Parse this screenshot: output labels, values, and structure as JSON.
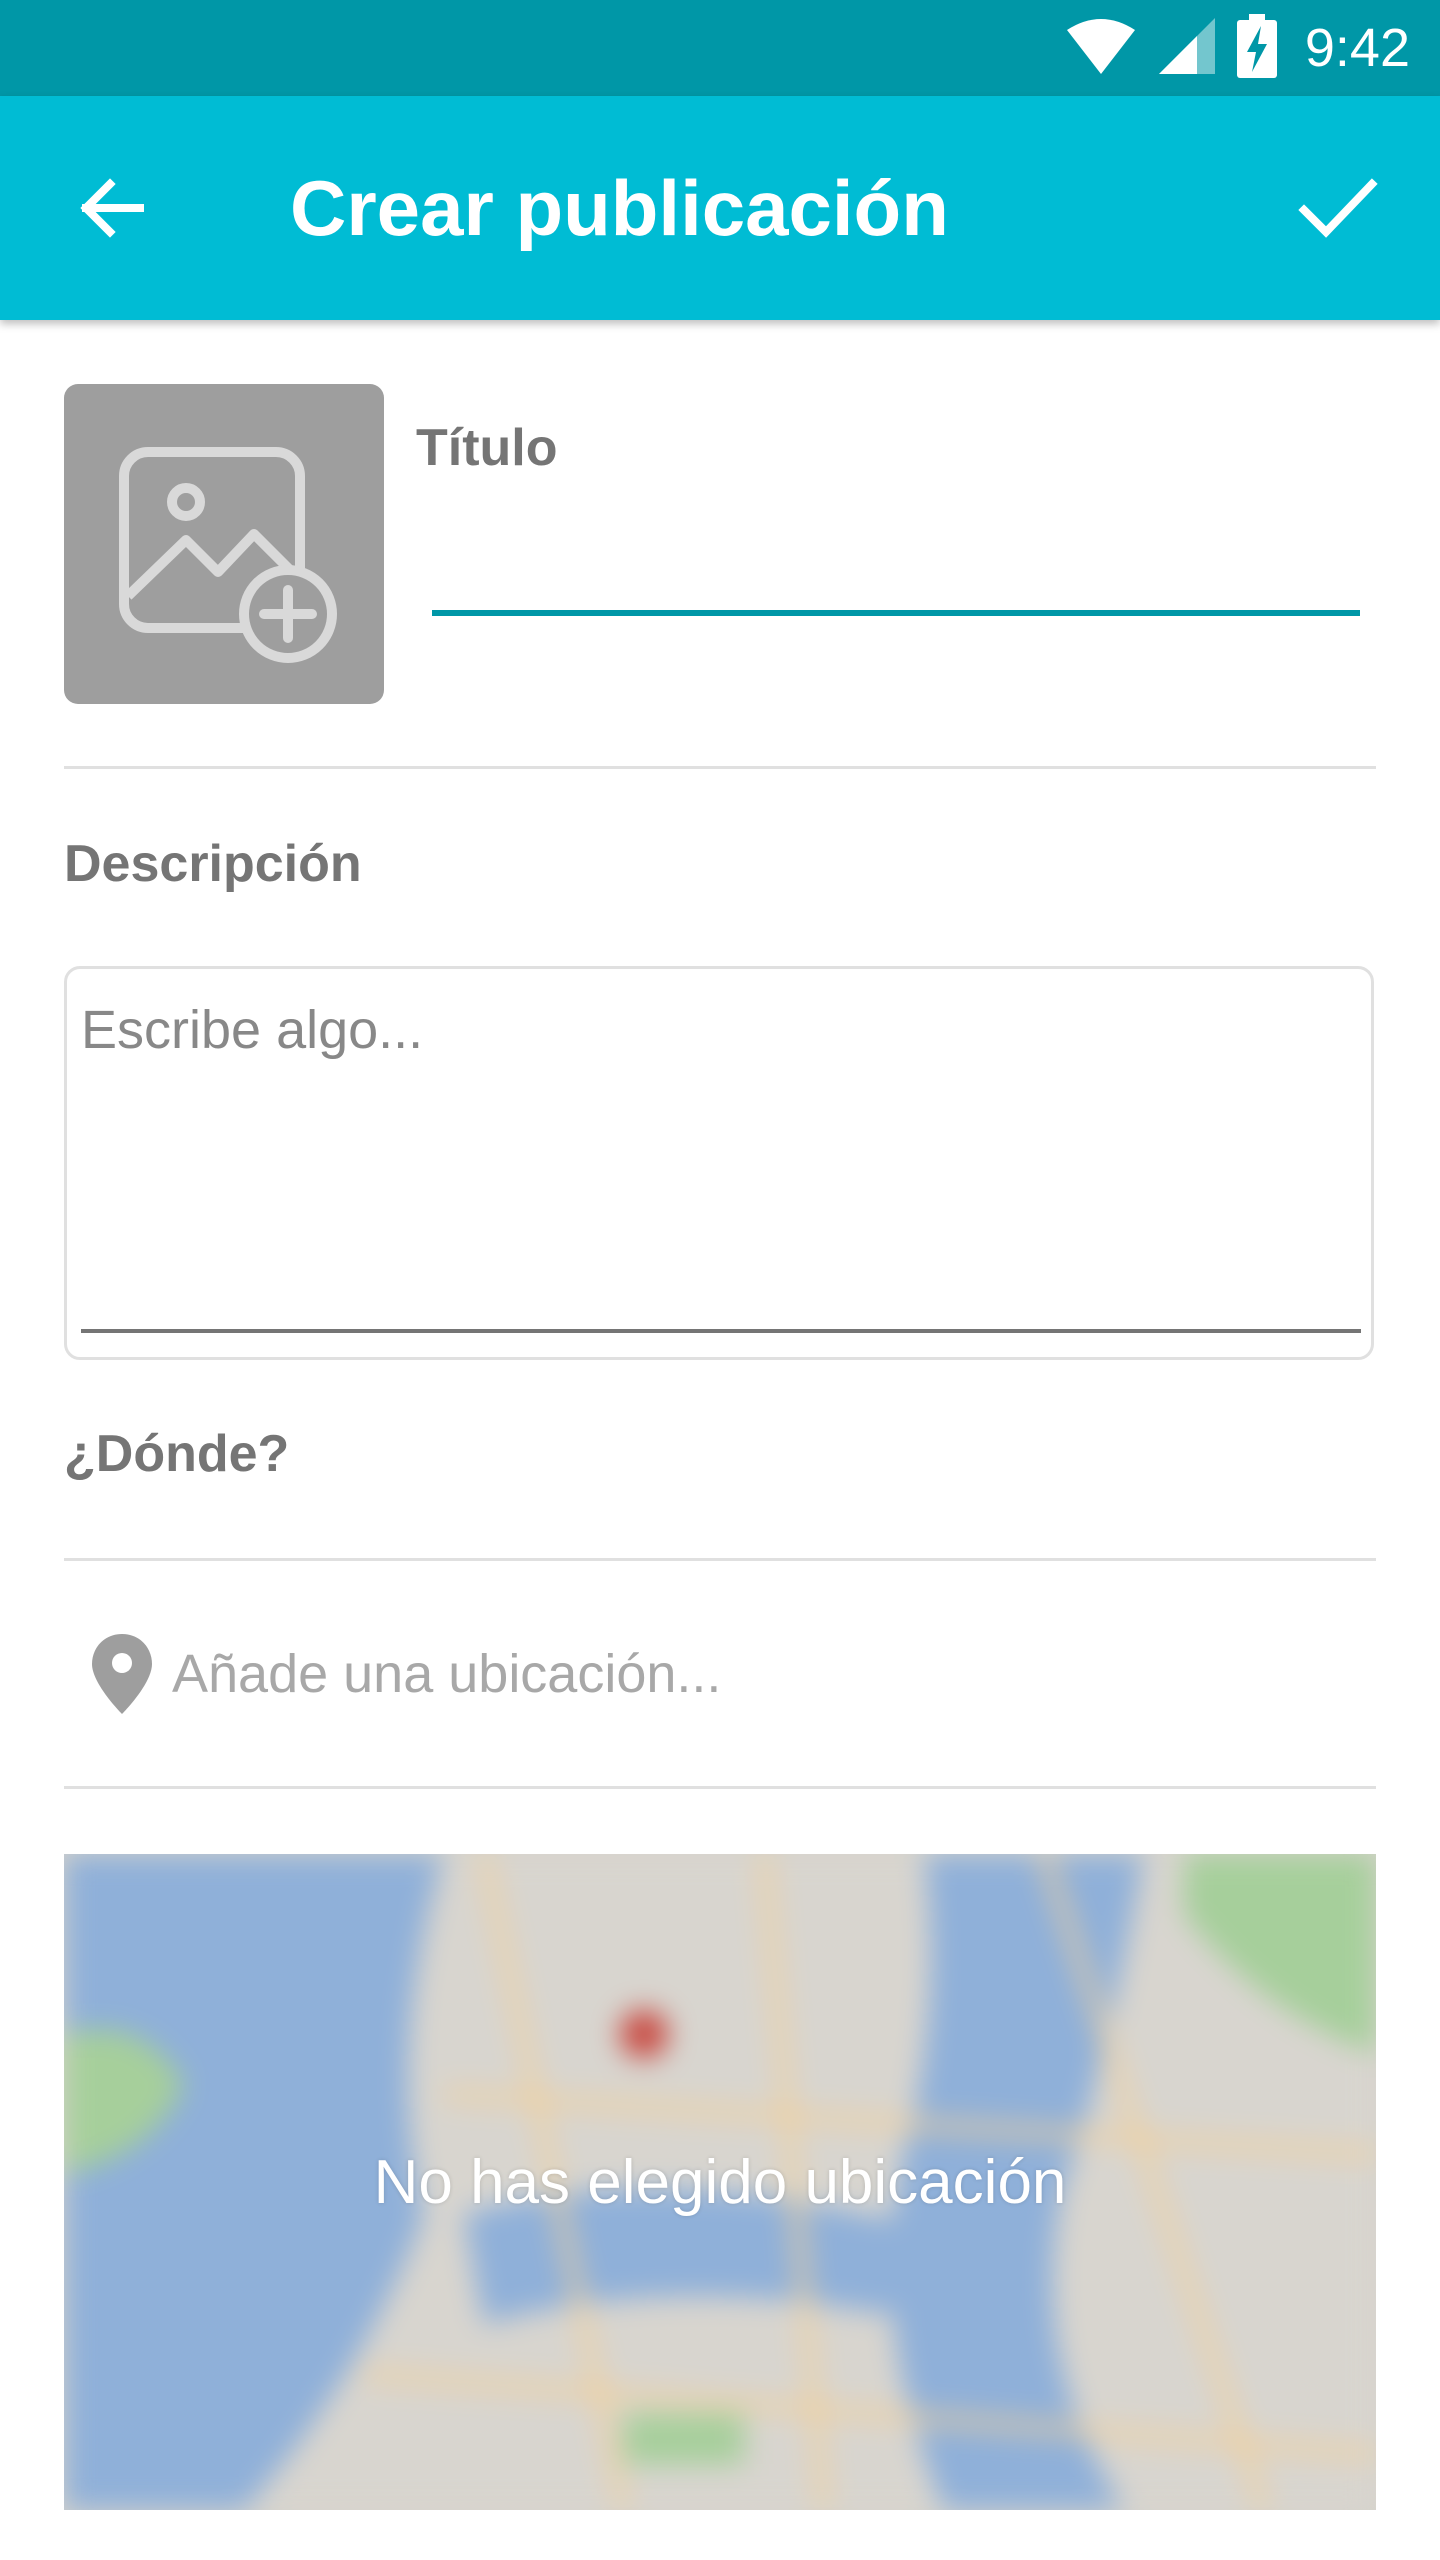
{
  "status_bar": {
    "time": "9:42",
    "icons": [
      "wifi-icon",
      "signal-icon",
      "battery-charging-icon"
    ]
  },
  "app_bar": {
    "title": "Crear publicación",
    "back_icon": "arrow-left-icon",
    "confirm_icon": "check-icon"
  },
  "form": {
    "image_picker_icon": "add-photo-icon",
    "title_label": "Título",
    "title_value": "",
    "description_label": "Descripción",
    "description_placeholder": "Escribe algo...",
    "description_value": "",
    "where_label": "¿Dónde?",
    "location_placeholder": "Añade una ubicación...",
    "location_value": "",
    "location_icon": "map-pin-icon"
  },
  "map": {
    "message": "No has elegido ubicación"
  },
  "colors": {
    "status_bar": "#0097a7",
    "app_bar": "#00bcd4",
    "accent": "#0097a7",
    "label": "#757575",
    "divider": "#e0e0e0"
  }
}
